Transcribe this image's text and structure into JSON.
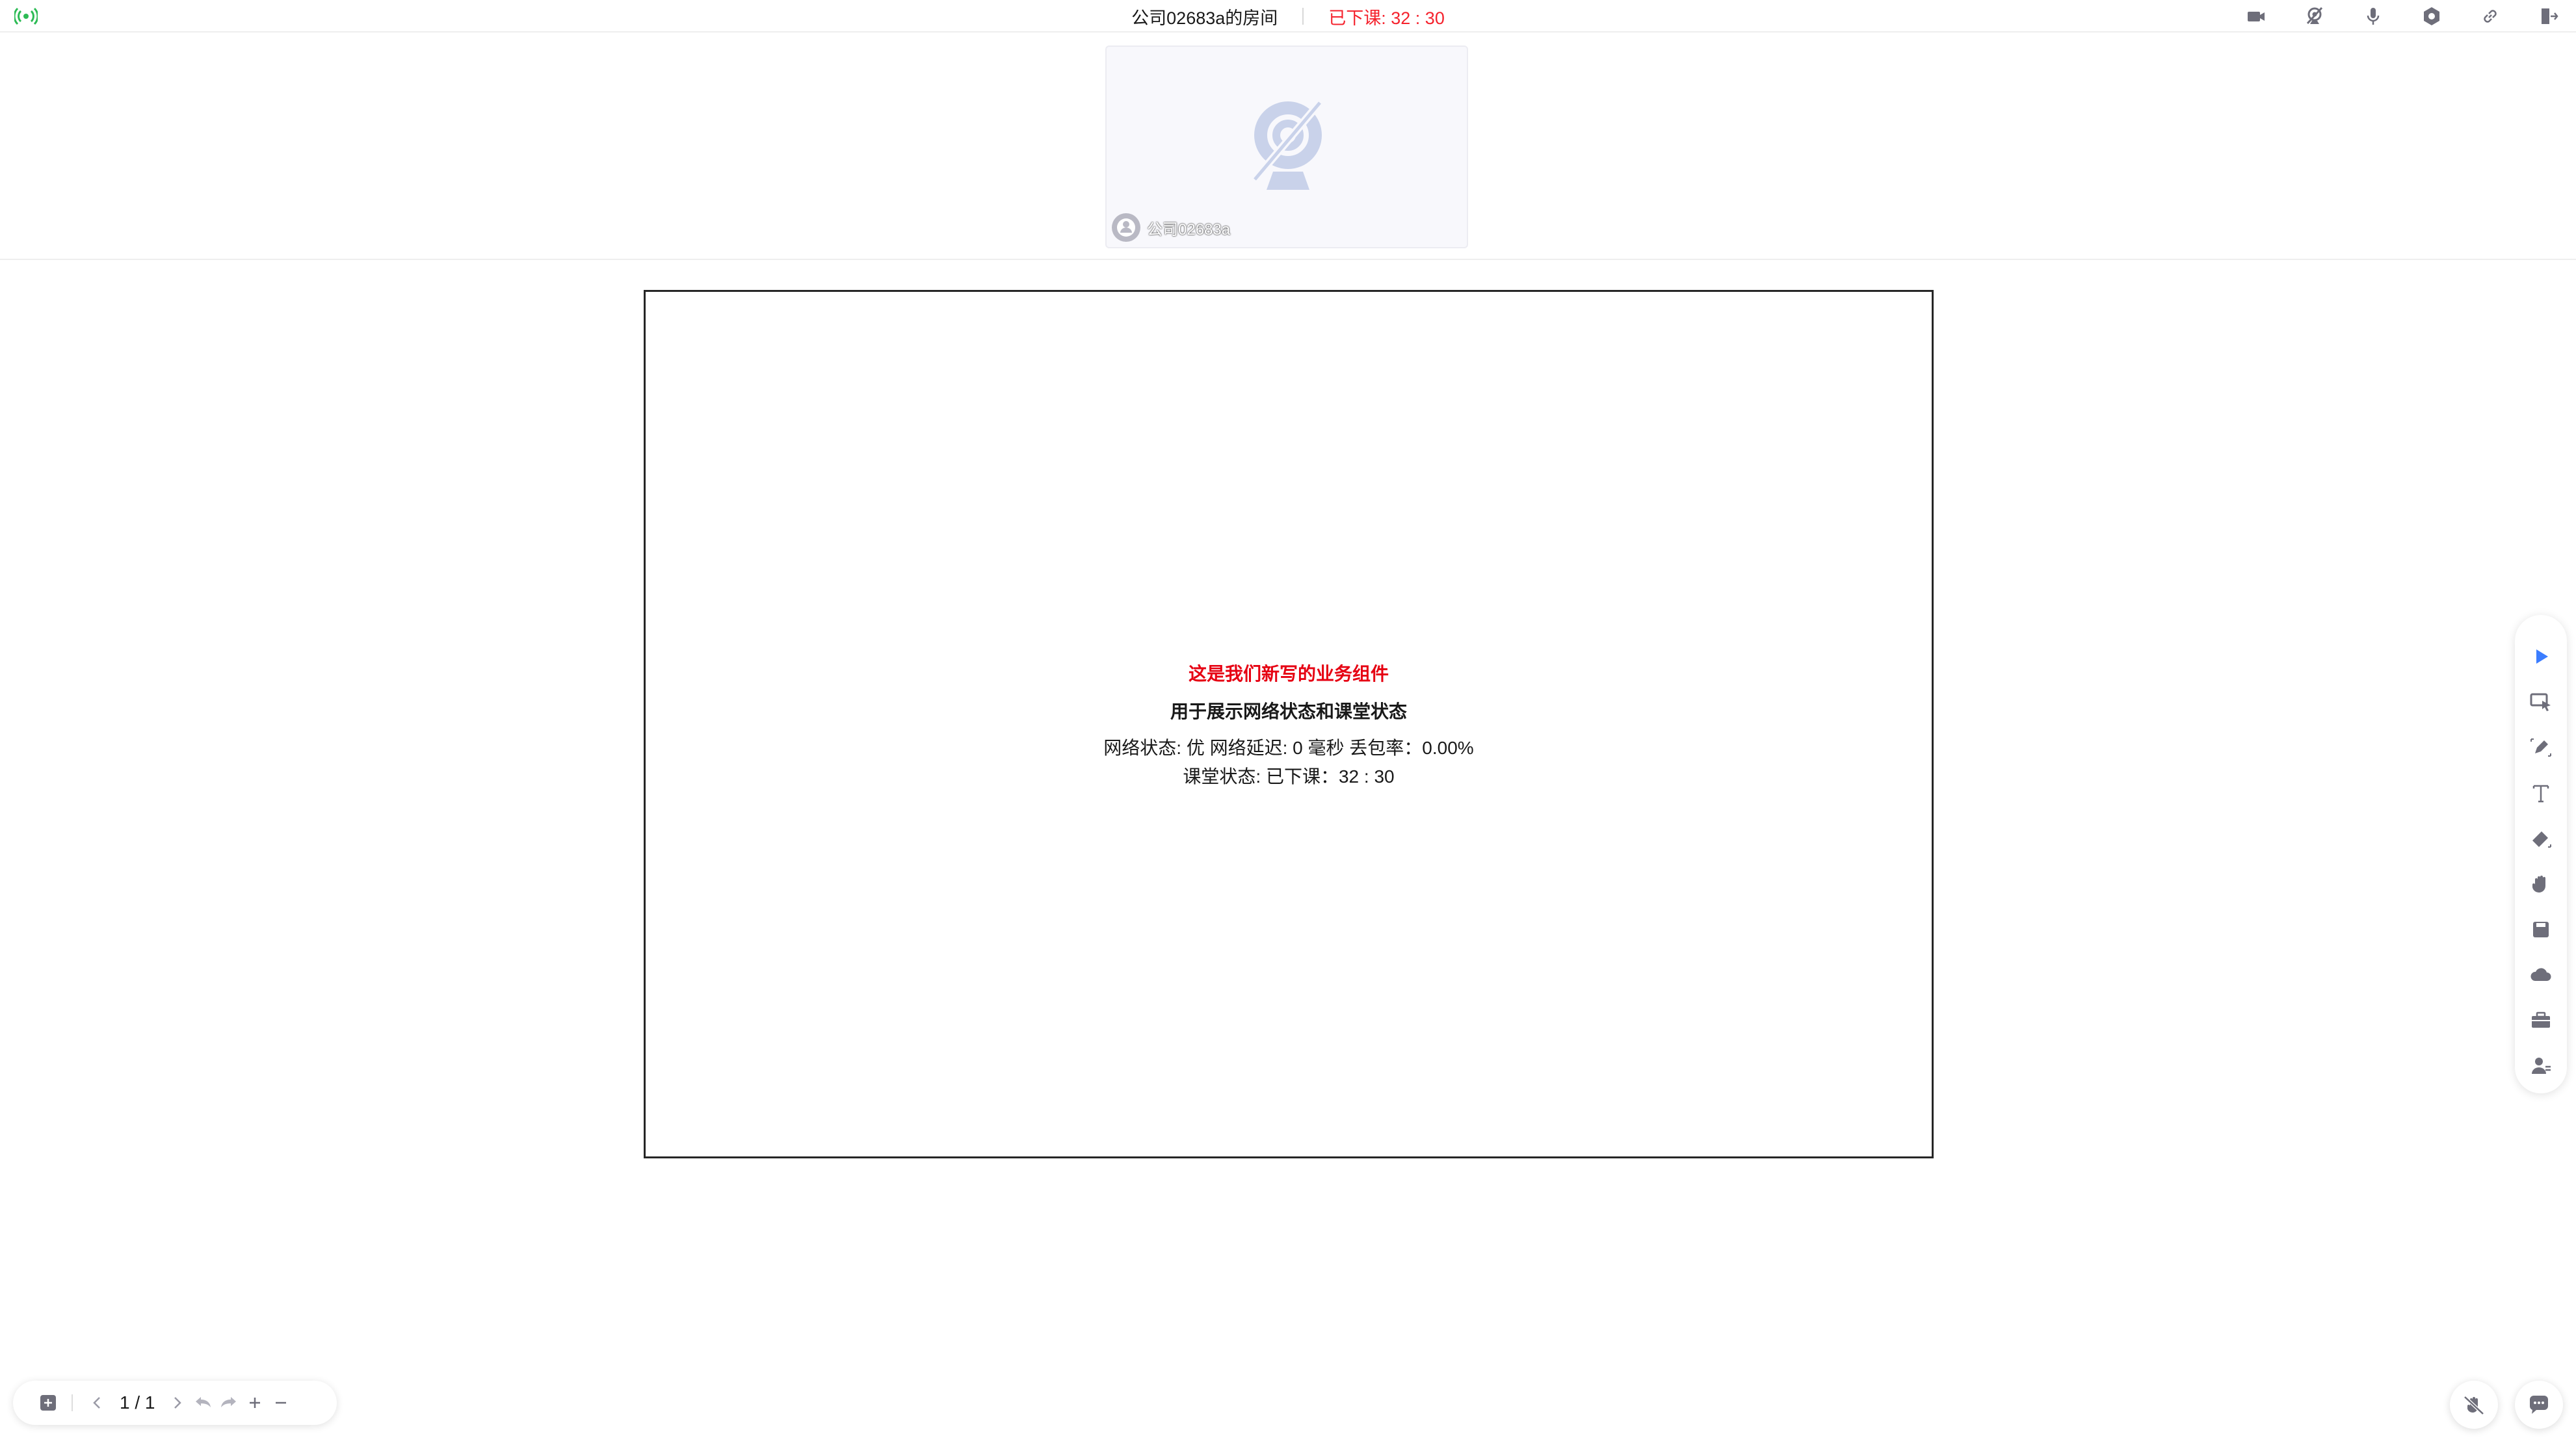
{
  "header": {
    "room_name": "公司02683a的房间",
    "class_state": "已下课: 32 : 30",
    "signal_icon": "signal-icon",
    "icons": [
      "camera-icon",
      "camera-off-icon",
      "microphone-icon",
      "settings-icon",
      "link-icon",
      "exit-icon"
    ]
  },
  "video": {
    "user_name": "公司02683a",
    "camera_status_icon": "camera-off-icon"
  },
  "board": {
    "widget_title": "这是我们新写的业务组件",
    "widget_subtitle": "用于展示网络状态和课堂状态",
    "network_line": "网络状态: 优 网络延迟: 0 毫秒 丢包率：0.00%",
    "class_line": "课堂状态: 已下课：32 : 30"
  },
  "tools": [
    "pointer-icon",
    "selector-icon",
    "pen-icon",
    "text-icon",
    "eraser-icon",
    "hand-icon",
    "save-icon",
    "cloud-icon",
    "toolbox-icon",
    "user-list-icon"
  ],
  "pager": {
    "page_indicator": "1 / 1"
  },
  "colors": {
    "accent": "#3b7dff",
    "danger": "#f5222d",
    "signal": "#2dbb55",
    "icon_gray": "#6e6e7a"
  }
}
